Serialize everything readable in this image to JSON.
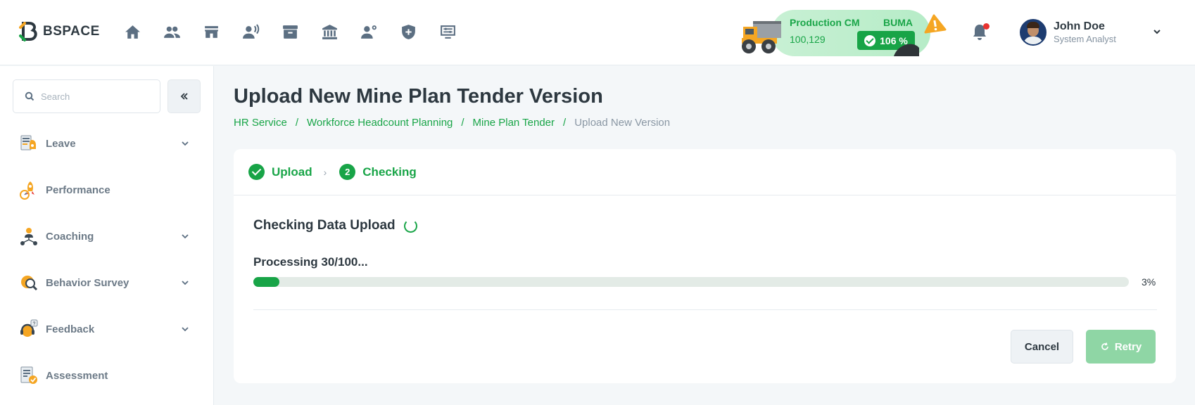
{
  "brand": {
    "name": "BSPACE",
    "accent": "#18a447"
  },
  "nav": {
    "icons": [
      "home-icon",
      "people-icon",
      "store-icon",
      "voice-user-icon",
      "archive-icon",
      "bank-icon",
      "user-settings-icon",
      "shield-plus-icon",
      "monitor-settings-icon"
    ]
  },
  "production": {
    "label": "Production CM",
    "value": "100,129",
    "buma_label": "BUMA",
    "buma_pct": "106 %"
  },
  "user": {
    "name": "John Doe",
    "role": "System Analyst"
  },
  "sidebar": {
    "search_placeholder": "Search",
    "items": [
      {
        "label": "Leave",
        "has_children": true
      },
      {
        "label": "Performance",
        "has_children": false
      },
      {
        "label": "Coaching",
        "has_children": true
      },
      {
        "label": "Behavior Survey",
        "has_children": true
      },
      {
        "label": "Feedback",
        "has_children": true
      },
      {
        "label": "Assessment",
        "has_children": false
      }
    ]
  },
  "page": {
    "title": "Upload New Mine Plan Tender Version",
    "breadcrumb": [
      "HR Service",
      "Workforce Headcount Planning",
      "Mine Plan Tender",
      "Upload New Version"
    ]
  },
  "steps": [
    {
      "label": "Upload",
      "state": "done"
    },
    {
      "label": "Checking",
      "number": "2",
      "state": "active"
    }
  ],
  "checking": {
    "title": "Checking Data Upload",
    "processing": "Processing 30/100...",
    "progress_percent": 3,
    "progress_label": "3%"
  },
  "actions": {
    "cancel": "Cancel",
    "retry": "Retry"
  }
}
